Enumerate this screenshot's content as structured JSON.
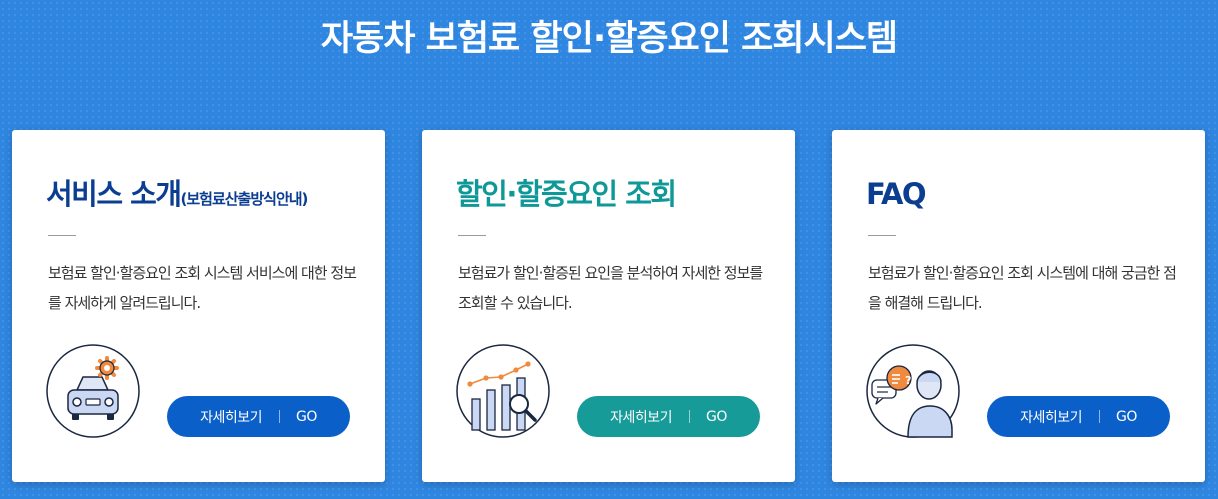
{
  "header": {
    "title": "자동차 보험료 할인·할증요인 조회시스템"
  },
  "cards": [
    {
      "title": "서비스 소개",
      "title_sub": "(보험료산출방식안내)",
      "description": "보험료 할인·할증요인 조회 시스템 서비스에 대한 정보를 자세하게 알려드립니다.",
      "icon": "car-gear-icon",
      "button_label": "자세히보기",
      "button_go": "GO"
    },
    {
      "title": "할인·할증요인 조회",
      "description": "보험료가 할인·할증된 요인을 분석하여 자세한 정보를 조회할 수 있습니다.",
      "icon": "chart-magnifier-icon",
      "button_label": "자세히보기",
      "button_go": "GO"
    },
    {
      "title": "FAQ",
      "description": "보험료가 할인·할증요인 조회 시스템에 대해 궁금한 점을 해결해 드립니다.",
      "icon": "person-question-icon",
      "button_label": "자세히보기",
      "button_go": "GO"
    }
  ],
  "colors": {
    "background": "#2f86e1",
    "title_navy": "#0b3d91",
    "title_teal": "#0f9898",
    "button_blue": "#0a60c8",
    "button_teal": "#169b98"
  }
}
